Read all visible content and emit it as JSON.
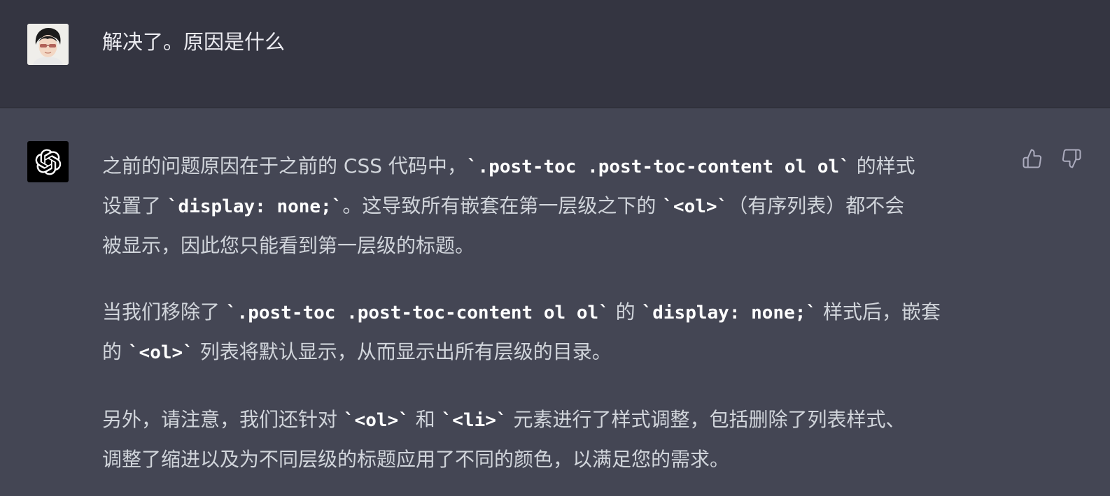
{
  "user": {
    "message": "解决了。原因是什么"
  },
  "assistant": {
    "paragraphs": [
      {
        "lines": [
          [
            {
              "t": "text",
              "v": "之前的问题原因在于之前的 CSS 代码中，"
            },
            {
              "t": "code",
              "v": "`.post-toc .post-toc-content ol ol`"
            },
            {
              "t": "text",
              "v": " 的样式"
            }
          ],
          [
            {
              "t": "text",
              "v": "设置了 "
            },
            {
              "t": "code",
              "v": "`display: none;`"
            },
            {
              "t": "text",
              "v": "。这导致所有嵌套在第一层级之下的 "
            },
            {
              "t": "code",
              "v": "`<ol>`"
            },
            {
              "t": "text",
              "v": "（有序列表）都不会"
            }
          ],
          [
            {
              "t": "text",
              "v": "被显示，因此您只能看到第一层级的标题。"
            }
          ]
        ]
      },
      {
        "lines": [
          [
            {
              "t": "text",
              "v": "当我们移除了 "
            },
            {
              "t": "code",
              "v": "`.post-toc .post-toc-content ol ol`"
            },
            {
              "t": "text",
              "v": " 的 "
            },
            {
              "t": "code",
              "v": "`display: none;`"
            },
            {
              "t": "text",
              "v": " 样式后，嵌套"
            }
          ],
          [
            {
              "t": "text",
              "v": "的 "
            },
            {
              "t": "code",
              "v": "`<ol>`"
            },
            {
              "t": "text",
              "v": " 列表将默认显示，从而显示出所有层级的目录。"
            }
          ]
        ]
      },
      {
        "lines": [
          [
            {
              "t": "text",
              "v": "另外，请注意，我们还针对 "
            },
            {
              "t": "code",
              "v": "`<ol>`"
            },
            {
              "t": "text",
              "v": " 和 "
            },
            {
              "t": "code",
              "v": "`<li>`"
            },
            {
              "t": "text",
              "v": " 元素进行了样式调整，包括删除了列表样式、"
            }
          ],
          [
            {
              "t": "text",
              "v": "调整了缩进以及为不同层级的标题应用了不同的颜色，以满足您的需求。"
            }
          ]
        ]
      }
    ]
  },
  "icons": {
    "user_avatar": "user-avatar",
    "assistant_avatar": "openai-logo-icon",
    "thumbs_up": "thumbs-up-icon",
    "thumbs_down": "thumbs-down-icon"
  },
  "colors": {
    "user_bg": "#343541",
    "assistant_bg": "#444654",
    "user_text": "#ececf1",
    "assistant_text": "#d1d5db",
    "code_text": "#ffffff",
    "icon": "#acacbe"
  }
}
